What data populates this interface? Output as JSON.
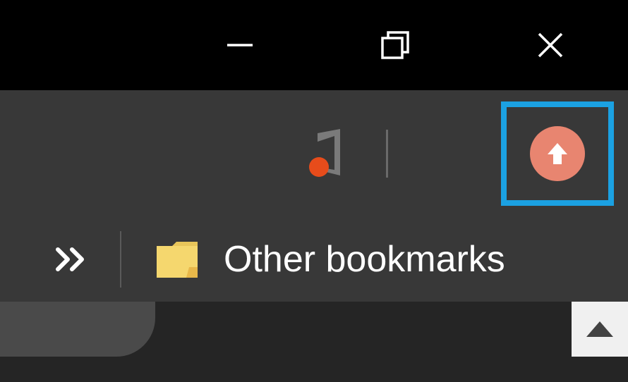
{
  "titlebar": {
    "minimize": "minimize",
    "maximize": "maximize",
    "close": "close"
  },
  "toolbar": {
    "extension_name": "office",
    "upload_button": "upload"
  },
  "bookmarks": {
    "overflow": "overflow",
    "folder_label": "Other bookmarks"
  },
  "colors": {
    "highlight": "#1ba1e2",
    "upload_bg": "#e88570",
    "office_dot": "#e74c1b",
    "folder": "#f5d76e"
  }
}
